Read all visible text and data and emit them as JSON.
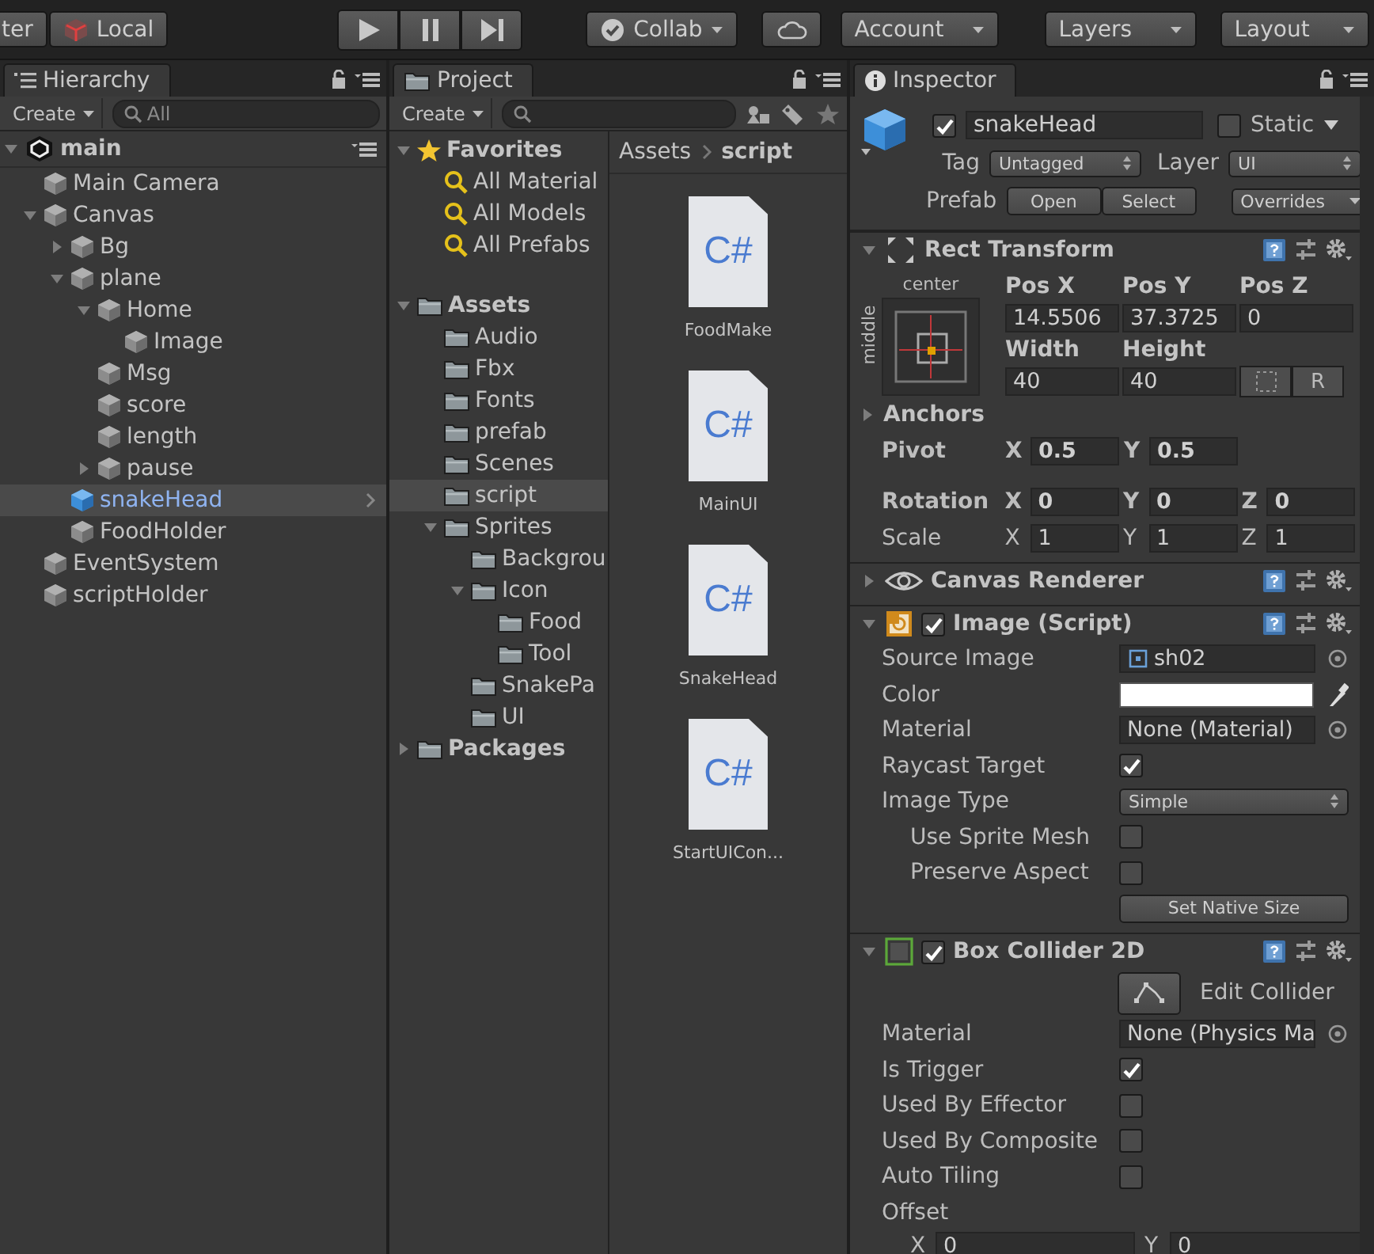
{
  "toolbar": {
    "pivot_label": "ter",
    "space_label": "Local",
    "collab": "Collab",
    "account": "Account",
    "layers": "Layers",
    "layout": "Layout"
  },
  "hierarchy": {
    "title": "Hierarchy",
    "create": "Create",
    "search_placeholder": "All",
    "scene": "main",
    "items": [
      {
        "label": "Main Camera",
        "prefab": false,
        "selected": false
      },
      {
        "label": "Canvas",
        "expanded": true,
        "prefab": false,
        "selected": false,
        "children": [
          {
            "label": "Bg",
            "expanded": false,
            "prefab": false,
            "selected": false
          },
          {
            "label": "plane",
            "expanded": true,
            "prefab": false,
            "selected": false,
            "children": [
              {
                "label": "Home",
                "expanded": true,
                "prefab": false,
                "selected": false,
                "children": [
                  {
                    "label": "Image",
                    "prefab": false,
                    "selected": false
                  }
                ]
              },
              {
                "label": "Msg",
                "prefab": false,
                "selected": false
              },
              {
                "label": "score",
                "prefab": false,
                "selected": false
              },
              {
                "label": "length",
                "prefab": false,
                "selected": false
              },
              {
                "label": "pause",
                "expanded": false,
                "prefab": false,
                "selected": false
              }
            ]
          },
          {
            "label": "snakeHead",
            "prefab": true,
            "selected": true
          },
          {
            "label": "FoodHolder",
            "prefab": false,
            "selected": false
          }
        ]
      },
      {
        "label": "EventSystem",
        "prefab": false,
        "selected": false
      },
      {
        "label": "scriptHolder",
        "prefab": false,
        "selected": false
      }
    ]
  },
  "project": {
    "title": "Project",
    "create": "Create",
    "tree": [
      {
        "label": "Favorites",
        "kind": "favorites",
        "expanded": true,
        "selected": false,
        "children": [
          {
            "label": "All Material",
            "kind": "search",
            "selected": false
          },
          {
            "label": "All Models",
            "kind": "search",
            "selected": false
          },
          {
            "label": "All Prefabs",
            "kind": "search",
            "selected": false
          }
        ]
      },
      {
        "label": "Assets",
        "kind": "root",
        "expanded": true,
        "selected": false,
        "children": [
          {
            "label": "Audio",
            "kind": "folder",
            "selected": false
          },
          {
            "label": "Fbx",
            "kind": "folder",
            "selected": false
          },
          {
            "label": "Fonts",
            "kind": "folder",
            "selected": false
          },
          {
            "label": "prefab",
            "kind": "folder",
            "selected": false
          },
          {
            "label": "Scenes",
            "kind": "folder",
            "selected": false
          },
          {
            "label": "script",
            "kind": "folder",
            "selected": true
          },
          {
            "label": "Sprites",
            "kind": "folder",
            "expanded": true,
            "selected": false,
            "children": [
              {
                "label": "Backgrou",
                "kind": "folder",
                "selected": false
              },
              {
                "label": "Icon",
                "kind": "folder",
                "expanded": true,
                "selected": false,
                "children": [
                  {
                    "label": "Food",
                    "kind": "folder",
                    "selected": false
                  },
                  {
                    "label": "Tool",
                    "kind": "folder",
                    "selected": false
                  }
                ]
              },
              {
                "label": "SnakePa",
                "kind": "folder",
                "selected": false
              },
              {
                "label": "UI",
                "kind": "folder",
                "selected": false
              }
            ]
          }
        ]
      },
      {
        "label": "Packages",
        "kind": "root",
        "expanded": false,
        "selected": false
      }
    ],
    "breadcrumb": [
      "Assets",
      "script"
    ],
    "files": [
      {
        "name": "FoodMake",
        "badge": "C#"
      },
      {
        "name": "MainUI",
        "badge": "C#"
      },
      {
        "name": "SnakeHead",
        "badge": "C#"
      },
      {
        "name": "StartUICon...",
        "badge": "C#"
      }
    ]
  },
  "inspector": {
    "title": "Inspector",
    "object": {
      "active": true,
      "name": "snakeHead",
      "static": false,
      "static_label": "Static",
      "tag_label": "Tag",
      "tag": "Untagged",
      "layer_label": "Layer",
      "layer": "UI",
      "prefab_label": "Prefab",
      "prefab_buttons": [
        "Open",
        "Select"
      ],
      "overrides": "Overrides"
    },
    "components": [
      {
        "kind": "rect_transform",
        "title": "Rect Transform",
        "expanded": true,
        "anchor_h": "center",
        "anchor_v": "middle",
        "columns": [
          {
            "header": "Pos X",
            "value": "14.5506"
          },
          {
            "header": "Pos Y",
            "value": "37.3725"
          },
          {
            "header": "Pos Z",
            "value": "0"
          },
          {
            "header": "Width",
            "value": "40"
          },
          {
            "header": "Height",
            "value": "40"
          }
        ],
        "raw_label": "R",
        "anchors": {
          "label": "Anchors",
          "expanded": false
        },
        "rows": [
          {
            "label": "Pivot",
            "overridden": true,
            "fields": [
              {
                "axis": "X",
                "value": "0.5"
              },
              {
                "axis": "Y",
                "value": "0.5"
              }
            ]
          },
          {
            "label": "Rotation",
            "overridden": true,
            "fields": [
              {
                "axis": "X",
                "value": "0"
              },
              {
                "axis": "Y",
                "value": "0"
              },
              {
                "axis": "Z",
                "value": "0"
              }
            ]
          },
          {
            "label": "Scale",
            "overridden": false,
            "fields": [
              {
                "axis": "X",
                "value": "1"
              },
              {
                "axis": "Y",
                "value": "1"
              },
              {
                "axis": "Z",
                "value": "1"
              }
            ]
          }
        ]
      },
      {
        "kind": "renderer",
        "title": "Canvas Renderer",
        "expanded": false
      },
      {
        "kind": "image",
        "title": "Image (Script)",
        "expanded": true,
        "enabled": true,
        "props": [
          {
            "kind": "object",
            "label": "Source Image",
            "value": "sh02",
            "sprite": true
          },
          {
            "kind": "color",
            "label": "Color",
            "color": "#ffffff"
          },
          {
            "kind": "object",
            "label": "Material",
            "value": "None (Material)",
            "sprite": false
          },
          {
            "kind": "checkbox",
            "label": "Raycast Target",
            "checked": true,
            "indented": false
          },
          {
            "kind": "dropdown",
            "label": "Image Type",
            "value": "Simple"
          },
          {
            "kind": "checkbox",
            "label": "Use Sprite Mesh",
            "checked": false,
            "indented": true
          },
          {
            "kind": "checkbox",
            "label": "Preserve Aspect",
            "checked": false,
            "indented": true
          },
          {
            "kind": "button",
            "label": "Set Native Size"
          }
        ]
      },
      {
        "kind": "collider",
        "title": "Box Collider 2D",
        "expanded": true,
        "enabled": true,
        "props": [
          {
            "kind": "edit",
            "label": "Edit Collider"
          },
          {
            "kind": "object",
            "label": "Material",
            "value": "None (Physics Ma",
            "sprite": false
          },
          {
            "kind": "checkbox",
            "label": "Is Trigger",
            "checked": true,
            "indented": false
          },
          {
            "kind": "checkbox",
            "label": "Used By Effector",
            "checked": false,
            "indented": false
          },
          {
            "kind": "checkbox",
            "label": "Used By Composite",
            "checked": false,
            "indented": false
          },
          {
            "kind": "checkbox",
            "label": "Auto Tiling",
            "checked": false,
            "indented": false
          },
          {
            "kind": "vector",
            "label": "Offset",
            "fields": [
              {
                "axis": "X",
                "value": "0"
              },
              {
                "axis": "Y",
                "value": "0"
              }
            ]
          }
        ]
      }
    ]
  }
}
